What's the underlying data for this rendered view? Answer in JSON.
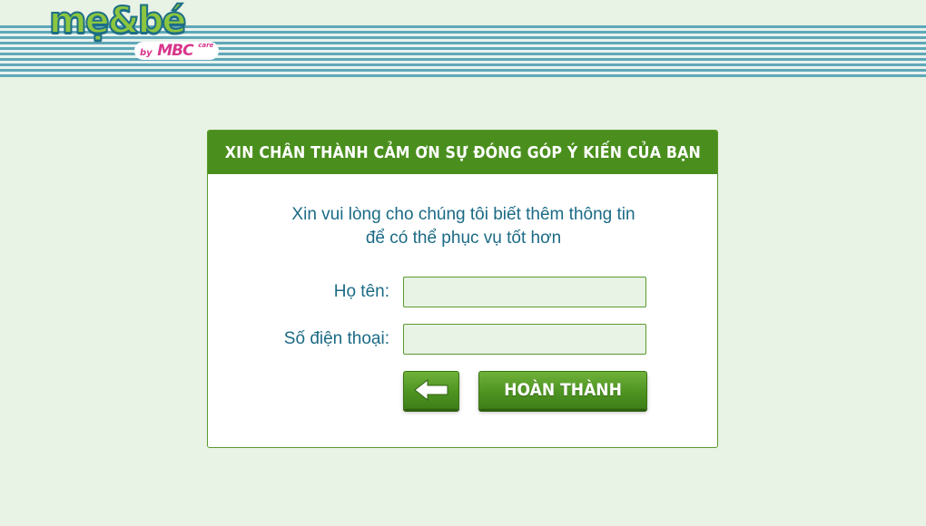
{
  "brand": {
    "logo_text": "mẹ&bé",
    "logo_by": "by",
    "logo_mbc": "MBC",
    "logo_care": "care"
  },
  "panel": {
    "title": "XIN CHÂN THÀNH CẢM ƠN SỰ ĐÓNG GÓP Ý KIẾN CỦA BẠN",
    "intro_line1": "Xin vui lòng cho chúng tôi biết thêm thông tin",
    "intro_line2": "để có thể phục vụ tốt hơn"
  },
  "form": {
    "name_label": "Họ tên:",
    "name_value": "",
    "name_placeholder": "",
    "phone_label": "Số điện thoại:",
    "phone_value": "",
    "phone_placeholder": ""
  },
  "buttons": {
    "back_icon": "arrow-left-icon",
    "finish_label": "HOÀN THÀNH"
  },
  "colors": {
    "accent_green": "#4a8f1d",
    "text_teal": "#1b6a85",
    "background": "#e8f2e5"
  }
}
